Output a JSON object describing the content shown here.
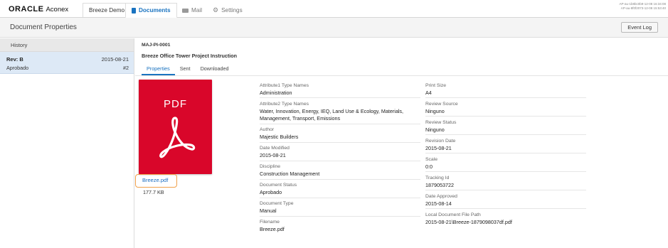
{
  "topnav": {
    "brand_oracle": "ORACLE",
    "brand_aconex": "Aconex",
    "project_tab": "Breeze Demo",
    "documents_tab": "Documents",
    "mail_tab": "Mail",
    "settings_tab": "Settings",
    "server_info_1": "AP-au-1b8bc0b9-12-08 16:34:08",
    "server_info_2": "AP-au-8f0f2073-12-08 15:53:40"
  },
  "header": {
    "title": "Document Properties",
    "event_log_label": "Event Log"
  },
  "history": {
    "header": "History",
    "items": [
      {
        "rev": "Rev: B",
        "date": "2015-08-21",
        "status": "Aprobado",
        "number": "#2"
      }
    ]
  },
  "document": {
    "number": "MAJ-PI-0001",
    "title": "Breeze Office Tower Project Instruction",
    "tabs": [
      "Properties",
      "Sent",
      "Downloaded"
    ],
    "active_tab": "Properties",
    "thumbnail_text": "PDF",
    "file_name": "Breeze.pdf",
    "file_size": "177.7 KB"
  },
  "properties_col1": [
    {
      "label": "Attribute1 Type Names",
      "value": "Administration"
    },
    {
      "label": "Attribute2 Type Names",
      "value": "Water, Innovation, Energy, IEQ, Land Use & Ecology, Materials, Management, Transport, Emissions"
    },
    {
      "label": "Author",
      "value": "Majestic Builders"
    },
    {
      "label": "Date Modified",
      "value": "2015-08-21"
    },
    {
      "label": "Discipline",
      "value": "Construction Management"
    },
    {
      "label": "Document Status",
      "value": "Aprobado"
    },
    {
      "label": "Document Type",
      "value": "Manual"
    },
    {
      "label": "Filename",
      "value": "Breeze.pdf"
    }
  ],
  "properties_col2": [
    {
      "label": "Print Size",
      "value": "A4"
    },
    {
      "label": "Review Source",
      "value": "Ninguno"
    },
    {
      "label": "Review Status",
      "value": "Ninguno"
    },
    {
      "label": "Revision Date",
      "value": "2015-08-21"
    },
    {
      "label": "Scale",
      "value": "0:0"
    },
    {
      "label": "Tracking Id",
      "value": "1879053722"
    },
    {
      "label": "Date Approved",
      "value": "2015-08-14"
    },
    {
      "label": "Local Document File Path",
      "value": "2015-08-21\\Breeze-1879098037df.pdf"
    }
  ],
  "colors": {
    "accent": "#1a73c0",
    "pdf_red": "#d9062a",
    "selected_row": "#dde9f6",
    "highlight_outline": "#f0a04a"
  },
  "icons": {
    "documents": "document-icon",
    "mail": "mail-icon",
    "settings": "gear-icon",
    "pdf": "acrobat-pdf-icon"
  }
}
